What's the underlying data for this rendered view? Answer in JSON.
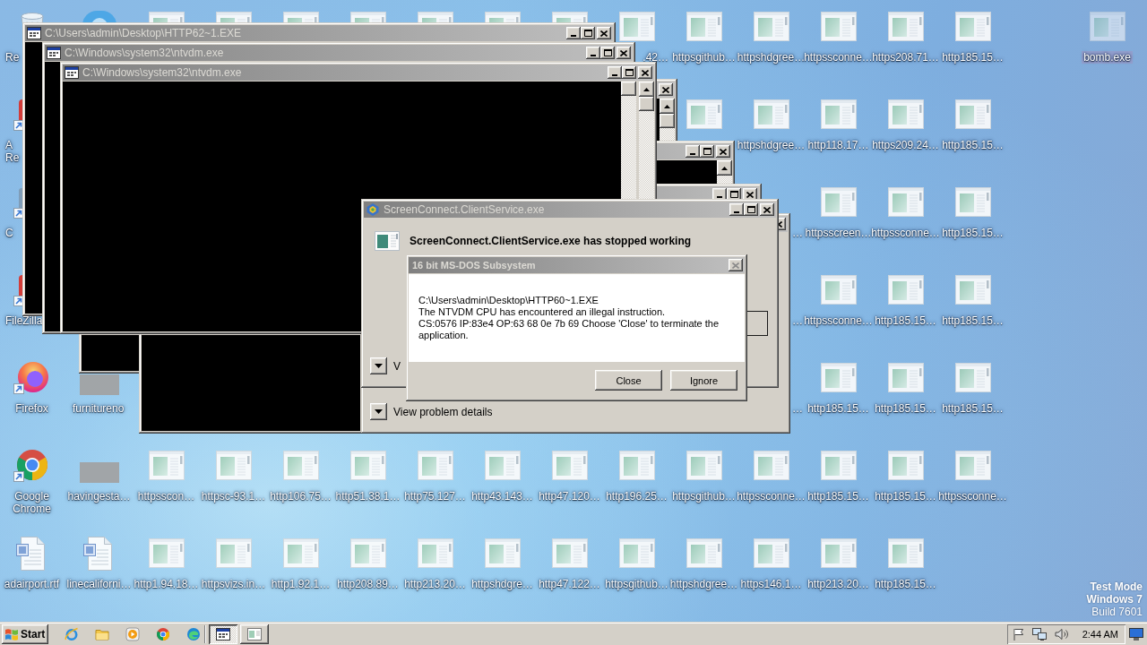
{
  "desktop": {
    "icon_rows": [
      [
        {
          "kind": "recycle-bin",
          "label": "Re",
          "clipped_right": true,
          "selected": false
        },
        {
          "kind": "app",
          "selected": false
        },
        {
          "kind": "program",
          "selected": false
        },
        {
          "kind": "program",
          "selected": false
        },
        {
          "kind": "program",
          "selected": false
        },
        {
          "kind": "program",
          "selected": false
        },
        {
          "kind": "program",
          "selected": false
        },
        {
          "kind": "program",
          "selected": false
        },
        {
          "kind": "program",
          "selected": false
        },
        {
          "kind": "program",
          "label": ".42…",
          "clipped_left": true,
          "selected": false
        },
        {
          "kind": "program",
          "label": "httpsgithub…",
          "selected": false
        },
        {
          "kind": "program",
          "label": "httpshdgree…",
          "selected": false
        },
        {
          "kind": "program",
          "label": "httpssconne…",
          "selected": false
        },
        {
          "kind": "program",
          "label": "https208.71…",
          "selected": false
        },
        {
          "kind": "program",
          "label": "http185.15…",
          "selected": false
        },
        null,
        {
          "kind": "program",
          "label": "bomb.exe",
          "selected": true
        }
      ],
      [
        {
          "kind": "shortcut",
          "label": "A\nRe",
          "clipped_right": true,
          "selected": false
        },
        null,
        null,
        null,
        null,
        null,
        null,
        null,
        null,
        null,
        {
          "kind": "program",
          "selected": false
        },
        {
          "kind": "program",
          "label": "httpshdgree…",
          "selected": false
        },
        {
          "kind": "program",
          "label": "http118.17…",
          "selected": false
        },
        {
          "kind": "program",
          "label": "https209.24…",
          "selected": false
        },
        {
          "kind": "program",
          "label": "http185.15…",
          "selected": false
        }
      ],
      [
        {
          "kind": "shortcut-plain",
          "label": "C",
          "clipped_right": true,
          "selected": false
        },
        null,
        null,
        null,
        null,
        null,
        null,
        null,
        null,
        null,
        null,
        {
          "label": "…",
          "clipped_left": true,
          "selected": false
        },
        {
          "kind": "program",
          "label": "httpsscreen…",
          "selected": false
        },
        {
          "kind": "program",
          "label": "httpssconne…",
          "selected": false
        },
        {
          "kind": "program",
          "label": "http185.15…",
          "selected": false
        }
      ],
      [
        {
          "kind": "shortcut",
          "label": "FileZilla",
          "clipped_right": true,
          "selected": false
        },
        null,
        null,
        null,
        null,
        null,
        null,
        null,
        null,
        null,
        null,
        {
          "label": "…",
          "clipped_left": true,
          "selected": false
        },
        {
          "kind": "program",
          "label": "httpssconne…",
          "selected": false
        },
        {
          "kind": "program",
          "label": "http185.15…",
          "selected": false
        },
        {
          "kind": "program",
          "label": "http185.15…",
          "selected": false
        }
      ],
      [
        {
          "kind": "firefox",
          "label": "Firefox",
          "selected": false
        },
        {
          "kind": "thumbnail",
          "label": "furnitureno",
          "clipped_right": true,
          "selected": false
        },
        null,
        null,
        null,
        null,
        null,
        null,
        null,
        null,
        null,
        {
          "label": "…",
          "clipped_left": true,
          "selected": false
        },
        {
          "kind": "program",
          "label": "http185.15…",
          "selected": false
        },
        {
          "kind": "program",
          "label": "http185.15…",
          "selected": false
        },
        {
          "kind": "program",
          "label": "http185.15…",
          "selected": false
        }
      ],
      [
        {
          "kind": "chrome",
          "label": "Google Chrome",
          "selected": false
        },
        {
          "kind": "thumbnail",
          "label": "havingesta…",
          "selected": false
        },
        {
          "kind": "program",
          "label": "httpsscon…",
          "selected": false
        },
        {
          "kind": "program",
          "label": "httpsc-93.1…",
          "selected": false
        },
        {
          "kind": "program",
          "label": "http106.75…",
          "selected": false
        },
        {
          "kind": "program",
          "label": "http51.38.1…",
          "selected": false
        },
        {
          "kind": "program",
          "label": "http75.127…",
          "selected": false
        },
        {
          "kind": "program",
          "label": "http43.143…",
          "selected": false
        },
        {
          "kind": "program",
          "label": "http47.120…",
          "selected": false
        },
        {
          "kind": "program",
          "label": "http196.25…",
          "selected": false
        },
        {
          "kind": "program",
          "label": "httpsgithub…",
          "selected": false
        },
        {
          "kind": "program",
          "label": "httpssconne…",
          "selected": false
        },
        {
          "kind": "program",
          "label": "http185.15…",
          "selected": false
        },
        {
          "kind": "program",
          "label": "http185.15…",
          "selected": false
        },
        {
          "kind": "program",
          "label": "httpssconne…",
          "selected": false
        }
      ],
      [
        {
          "kind": "document",
          "label": "adairport.rtf",
          "selected": false
        },
        {
          "kind": "document",
          "label": "linecaliforni…",
          "selected": false
        },
        {
          "kind": "program",
          "label": "http1.94.18…",
          "selected": false
        },
        {
          "kind": "program",
          "label": "httpsvizs.in…",
          "selected": false
        },
        {
          "kind": "program",
          "label": "http1.92.1…",
          "selected": false
        },
        {
          "kind": "program",
          "label": "http208.89…",
          "selected": false
        },
        {
          "kind": "program",
          "label": "http213.20…",
          "selected": false
        },
        {
          "kind": "program",
          "label": "httpshdgre…",
          "selected": false
        },
        {
          "kind": "program",
          "label": "http47.122…",
          "selected": false
        },
        {
          "kind": "program",
          "label": "httpsgithub…",
          "selected": false
        },
        {
          "kind": "program",
          "label": "httpshdgree…",
          "selected": false
        },
        {
          "kind": "program",
          "label": "https146.1…",
          "selected": false
        },
        {
          "kind": "program",
          "label": "http213.20…",
          "selected": false
        },
        {
          "kind": "program",
          "label": "http185.15…",
          "selected": false
        }
      ]
    ],
    "notice": [
      "Test Mode",
      "Windows 7",
      "Build 7601"
    ]
  },
  "windows": [
    {
      "kind": "console",
      "title": "C:\\Users\\admin\\Desktop\\HTTP62~1.EXE",
      "active": false
    },
    {
      "kind": "console",
      "title": "C:\\Windows\\system32\\ntvdm.exe",
      "active": false
    },
    {
      "kind": "console",
      "title": "C:\\Windows\\system32\\ntvdm.exe",
      "active": false
    },
    {
      "kind": "console",
      "active": false
    },
    {
      "kind": "console",
      "active": false
    },
    {
      "kind": "console",
      "active": false
    },
    {
      "kind": "console"
    },
    {
      "kind": "console"
    },
    {
      "kind": "error-report",
      "title": "ScreenConnect.ClientService.exe",
      "heading": "ScreenConnect.ClientService.exe has stopped working",
      "details_label": "V",
      "active": false
    },
    {
      "kind": "message-box",
      "title": "16 bit MS-DOS Subsystem",
      "close_disabled": true,
      "lines": [
        "C:\\Users\\admin\\Desktop\\HTTP60~1.EXE",
        "The NTVDM CPU has encountered an illegal instruction.",
        "CS:0576 IP:83e4 OP:63 68 0e 7b 69 Choose 'Close' to terminate the application."
      ],
      "buttons": [
        "Close",
        "Ignore"
      ],
      "active": false
    },
    {
      "kind": "error-report",
      "details_label": "View problem details",
      "active": false
    }
  ],
  "taskbar": {
    "start": "Start",
    "quick_launch": [
      {
        "kind": "ie"
      },
      {
        "kind": "folder"
      },
      {
        "kind": "media"
      },
      {
        "kind": "chrome"
      },
      {
        "kind": "edge"
      }
    ],
    "tasks": [
      {
        "kind": "console",
        "selected": true
      },
      {
        "kind": "window",
        "selected": false
      }
    ],
    "tray": [
      {
        "kind": "flag"
      },
      {
        "kind": "network"
      },
      {
        "kind": "volume"
      }
    ],
    "clock": "2:44 AM"
  }
}
